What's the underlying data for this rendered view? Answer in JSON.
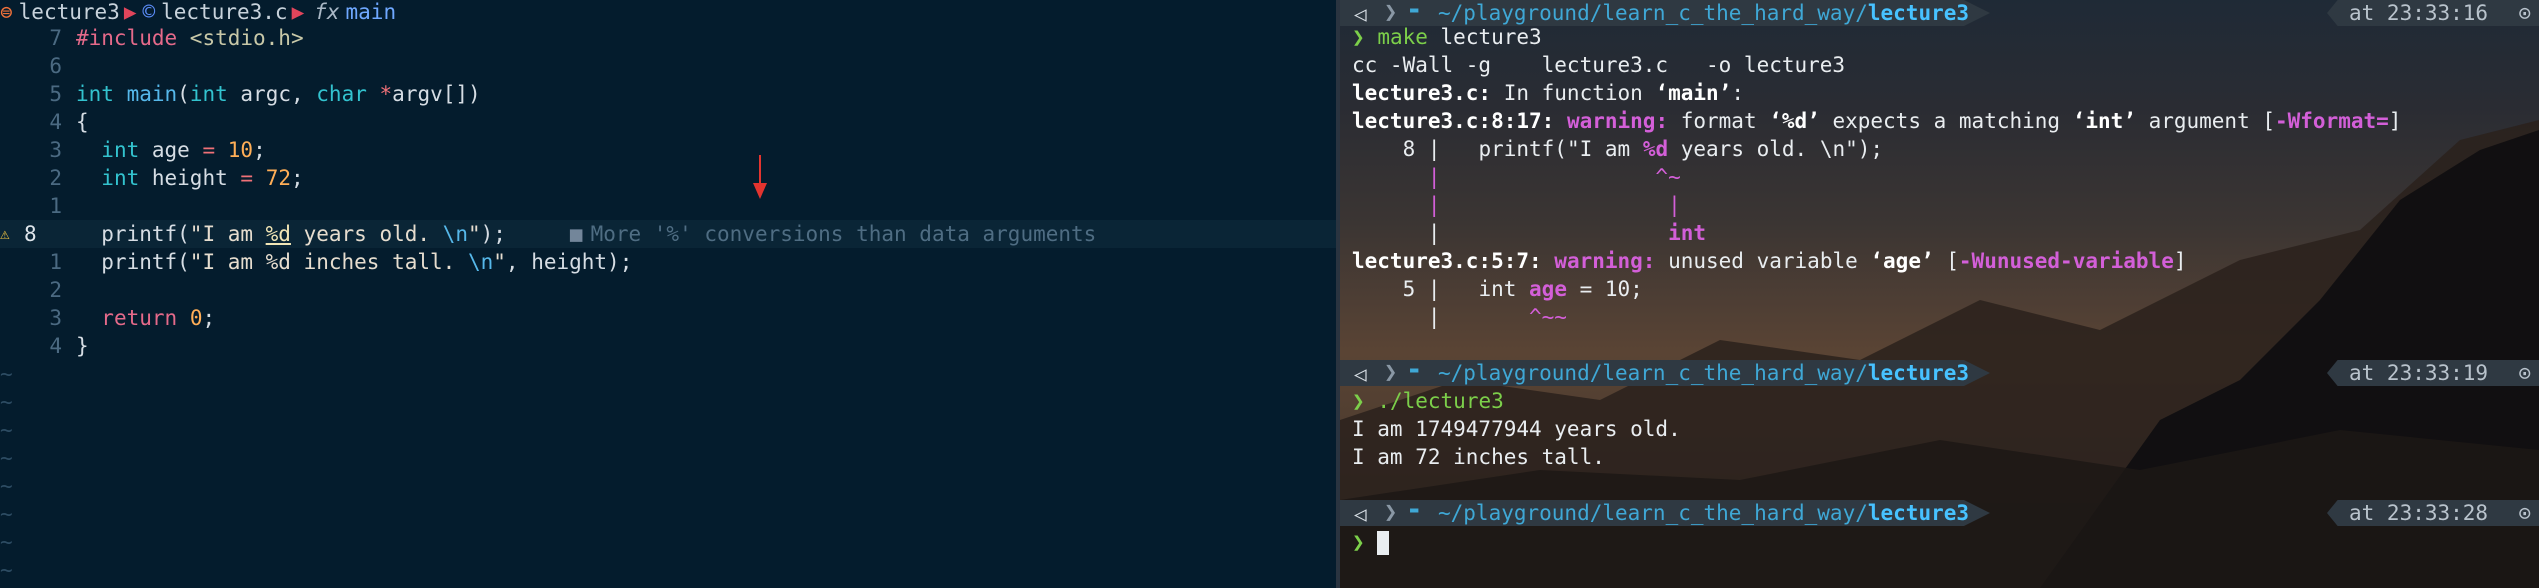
{
  "editor": {
    "breadcrumb": {
      "folder": "lecture3",
      "file": "lecture3.c",
      "function": "main",
      "fn_glyph": "fx"
    },
    "lines": [
      {
        "n": "7",
        "parts": [
          [
            "pp",
            "#include "
          ],
          [
            "inc",
            "<stdio.h>"
          ]
        ]
      },
      {
        "n": "6",
        "parts": []
      },
      {
        "n": "5",
        "parts": [
          [
            "type",
            "int"
          ],
          [
            "plain",
            " "
          ],
          [
            "kw",
            "main"
          ],
          [
            "plain",
            "("
          ],
          [
            "type",
            "int"
          ],
          [
            "plain",
            " argc, "
          ],
          [
            "type",
            "char"
          ],
          [
            "plain",
            " "
          ],
          [
            "op",
            "*"
          ],
          [
            "plain",
            "argv[])"
          ]
        ]
      },
      {
        "n": "4",
        "parts": [
          [
            "plain",
            "{"
          ]
        ]
      },
      {
        "n": "3",
        "parts": [
          [
            "plain",
            "  "
          ],
          [
            "type",
            "int"
          ],
          [
            "plain",
            " age "
          ],
          [
            "op",
            "="
          ],
          [
            "plain",
            " "
          ],
          [
            "num",
            "10"
          ],
          [
            "plain",
            ";"
          ]
        ]
      },
      {
        "n": "2",
        "parts": [
          [
            "plain",
            "  "
          ],
          [
            "type",
            "int"
          ],
          [
            "plain",
            " height "
          ],
          [
            "op",
            "="
          ],
          [
            "plain",
            " "
          ],
          [
            "num",
            "72"
          ],
          [
            "plain",
            ";"
          ]
        ]
      },
      {
        "n": "1",
        "parts": []
      },
      {
        "n": "8",
        "current": true,
        "warning": true,
        "parts": [
          [
            "plain",
            "  printf("
          ],
          [
            "str",
            "\"I am "
          ],
          [
            "fmt",
            "%d"
          ],
          [
            "str",
            " years old. "
          ],
          [
            "kw",
            "\\n"
          ],
          [
            "str",
            "\""
          ],
          [
            "plain",
            ");"
          ]
        ],
        "diagnostic": "More '%' conversions than data arguments"
      },
      {
        "n": "1",
        "parts": [
          [
            "plain",
            "  printf("
          ],
          [
            "str",
            "\"I am %d inches tall. "
          ],
          [
            "kw",
            "\\n"
          ],
          [
            "str",
            "\""
          ],
          [
            "plain",
            ", height);"
          ]
        ]
      },
      {
        "n": "2",
        "parts": []
      },
      {
        "n": "3",
        "parts": [
          [
            "plain",
            "  "
          ],
          [
            "pp",
            "return"
          ],
          [
            "plain",
            " "
          ],
          [
            "num",
            "0"
          ],
          [
            "plain",
            ";"
          ]
        ]
      },
      {
        "n": "4",
        "parts": [
          [
            "plain",
            "}"
          ]
        ]
      }
    ],
    "tilde_rows": 8,
    "tilde_char": "~"
  },
  "terminal": {
    "prompts": [
      {
        "path_prefix": "~/playground/learn_c_the_hard_way/",
        "path_last": "lecture3",
        "time": "at 23:33:16"
      },
      {
        "path_prefix": "~/playground/learn_c_the_hard_way/",
        "path_last": "lecture3",
        "time": "at 23:33:19"
      },
      {
        "path_prefix": "~/playground/learn_c_the_hard_way/",
        "path_last": "lecture3",
        "time": "at 23:33:28"
      }
    ],
    "prompt_char": "❯",
    "cmd1": {
      "name": "make",
      "arg": " lecture3"
    },
    "cmd2": "./lecture3",
    "build": {
      "cc": "cc -Wall -g    lecture3.c   -o lecture3",
      "infn_file": "lecture3.c:",
      "infn_text": " In function ",
      "infn_name": "‘main’",
      "infn_end": ":",
      "w1_loc": "lecture3.c:8:17: ",
      "w1_label": "warning:",
      "w1_t1": " format ",
      "w1_q1": "‘%d’",
      "w1_t2": " expects a matching ",
      "w1_q2": "‘int’",
      "w1_t3": " argument [",
      "w1_flag": "-Wformat=",
      "w1_t4": "]",
      "src8_no": "    8 |",
      "src8_a": "   printf(\"I am ",
      "src8_fmt": "%d",
      "src8_b": " years old. \\n\");",
      "caret1": "      |                 ^~",
      "bar1": "      |                  |",
      "int1_pre": "      |                  ",
      "int1": "int",
      "w2_loc": "lecture3.c:5:7: ",
      "w2_label": "warning:",
      "w2_t1": " unused variable ",
      "w2_q1": "‘age’",
      "w2_t2": " [",
      "w2_flag": "-Wunused-variable",
      "w2_t3": "]",
      "src5_no": "    5 |",
      "src5_a": "   int ",
      "src5_var": "age",
      "src5_b": " = 10;",
      "caret2_pre": "      |       ",
      "caret2": "^~~"
    },
    "output": [
      "I am 1749477944 years old.",
      "I am 72 inches tall."
    ]
  }
}
